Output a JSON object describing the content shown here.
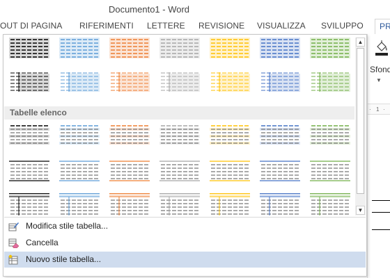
{
  "window": {
    "title": "Documento1 - Word"
  },
  "ribbon_tabs": [
    {
      "label": "OUT DI PAGINA"
    },
    {
      "label": "RIFERIMENTI"
    },
    {
      "label": "LETTERE"
    },
    {
      "label": "REVISIONE"
    },
    {
      "label": "VISUALIZZA"
    },
    {
      "label": "SVILUPPO"
    },
    {
      "label": "PR"
    }
  ],
  "right_group": {
    "label": "Sfondo"
  },
  "gallery": {
    "section_label": "Tabelle elenco",
    "colors": [
      "#000000",
      "#5b9bd5",
      "#ed7d31",
      "#a5a5a5",
      "#ffc000",
      "#4472c4",
      "#70ad47"
    ],
    "light_fills": [
      "#d9d9d9",
      "#ddebf7",
      "#fbe4d5",
      "#ededed",
      "#fff2cc",
      "#d9e2f3",
      "#e2efd9"
    ]
  },
  "menu": {
    "items": [
      {
        "label": "Modifica stile tabella...",
        "icon": "edit-table-style-icon"
      },
      {
        "label": "Cancella",
        "icon": "eraser-icon"
      },
      {
        "label": "Nuovo stile tabella...",
        "icon": "new-table-style-icon"
      }
    ]
  },
  "scroll": {
    "up": "▲",
    "down": "▼"
  }
}
